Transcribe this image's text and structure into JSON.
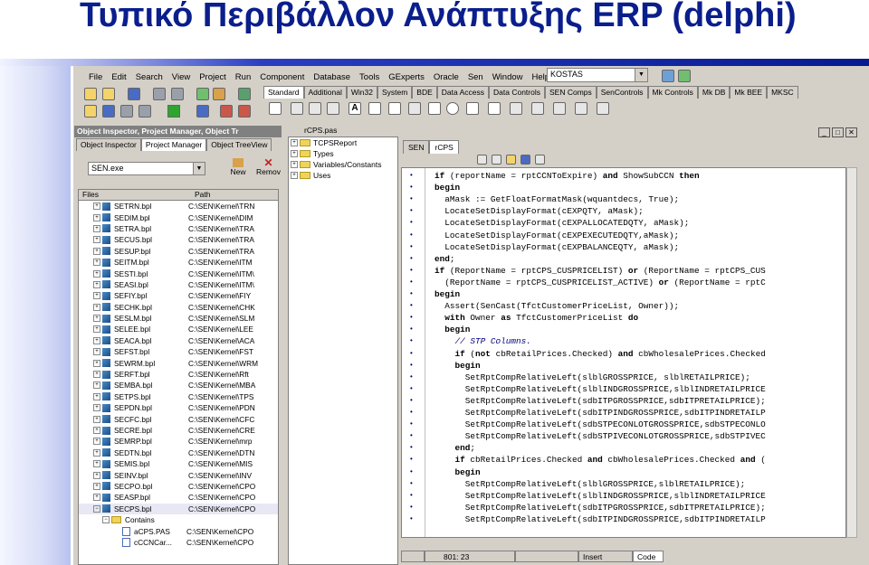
{
  "slide": {
    "title": "Τυπικό Περιβάλλον Ανάπτυξης ERP (delphi)"
  },
  "menu": [
    "File",
    "Edit",
    "Search",
    "View",
    "Project",
    "Run",
    "Component",
    "Database",
    "Tools",
    "GExperts",
    "Oracle",
    "Sen",
    "Window",
    "Help"
  ],
  "combo_value": "KOSTAS",
  "palette_tabs": [
    "Standard",
    "Additional",
    "Win32",
    "System",
    "BDE",
    "Data Access",
    "Data Controls",
    "SEN Comps",
    "SenControls",
    "Mk Controls",
    "Mk DB",
    "Mk BEE",
    "MKSC"
  ],
  "inspector": {
    "caption": "Object Inspector, Project Manager, Object Tr",
    "tabs": [
      "Object Inspector",
      "Project Manager",
      "Object TreeView"
    ],
    "project": "SEN.exe",
    "new_label": "New",
    "remove_label": "Remov",
    "col_files": "Files",
    "col_path": "Path",
    "files": [
      {
        "name": "SETRN.bpl",
        "path": "C:\\SEN\\Kernel\\TRN"
      },
      {
        "name": "SEDIM.bpl",
        "path": "C:\\SEN\\Kernel\\DIM"
      },
      {
        "name": "SETRA.bpl",
        "path": "C:\\SEN\\Kernel\\TRA"
      },
      {
        "name": "SECUS.bpl",
        "path": "C:\\SEN\\Kernel\\TRA"
      },
      {
        "name": "SESUP.bpl",
        "path": "C:\\SEN\\Kernel\\TRA"
      },
      {
        "name": "SEITM.bpl",
        "path": "C:\\SEN\\Kernel\\ITM"
      },
      {
        "name": "SESTI.bpl",
        "path": "C:\\SEN\\Kernel\\ITM\\"
      },
      {
        "name": "SEASI.bpl",
        "path": "C:\\SEN\\Kernel\\ITM\\"
      },
      {
        "name": "SEFIY.bpl",
        "path": "C:\\SEN\\Kernel\\FIY"
      },
      {
        "name": "SECHK.bpl",
        "path": "C:\\SEN\\Kernel\\CHK"
      },
      {
        "name": "SESLM.bpl",
        "path": "C:\\SEN\\Kernel\\SLM"
      },
      {
        "name": "SELEE.bpl",
        "path": "C:\\SEN\\Kernel\\LEE"
      },
      {
        "name": "SEACA.bpl",
        "path": "C:\\SEN\\Kernel\\ACA"
      },
      {
        "name": "SEFST.bpl",
        "path": "C:\\SEN\\Kernel\\FST"
      },
      {
        "name": "SEWRM.bpl",
        "path": "C:\\SEN\\Kernel\\WRM"
      },
      {
        "name": "SERFT.bpl",
        "path": "C:\\SEN\\Kernel\\Rft"
      },
      {
        "name": "SEMBA.bpl",
        "path": "C:\\SEN\\Kernel\\MBA"
      },
      {
        "name": "SETPS.bpl",
        "path": "C:\\SEN\\Kernel\\TPS"
      },
      {
        "name": "SEPDN.bpl",
        "path": "C:\\SEN\\Kernel\\PDN"
      },
      {
        "name": "SECFC.bpl",
        "path": "C:\\SEN\\Kernel\\CFC"
      },
      {
        "name": "SECRE.bpl",
        "path": "C:\\SEN\\Kernel\\CRE"
      },
      {
        "name": "SEMRP.bpl",
        "path": "C:\\SEN\\Kernel\\mrp"
      },
      {
        "name": "SEDTN.bpl",
        "path": "C:\\SEN\\Kernel\\DTN"
      },
      {
        "name": "SEMIS.bpl",
        "path": "C:\\SEN\\Kernel\\MIS"
      },
      {
        "name": "SEINV.bpl",
        "path": "C:\\SEN\\Kernel\\INV"
      },
      {
        "name": "SECPO.bpl",
        "path": "C:\\SEN\\Kernel\\CPO"
      },
      {
        "name": "SEASP.bpl",
        "path": "C:\\SEN\\Kernel\\CPO"
      },
      {
        "name": "SECPS.bpl",
        "path": "C:\\SEN\\Kernel\\CPO"
      }
    ],
    "contains": "Contains",
    "sub_files": [
      {
        "name": "aCPS.PAS",
        "path": "C:\\SEN\\Kernel\\CPO"
      },
      {
        "name": "cCCNCar...",
        "path": "C:\\SEN\\Kernel\\CPO"
      }
    ]
  },
  "tree": {
    "caption": "rCPS.pas",
    "items": [
      "TCPSReport",
      "Types",
      "Variables/Constants",
      "Uses"
    ]
  },
  "editor": {
    "tabs": [
      "SEN",
      "rCPS"
    ],
    "lines": [
      "if (reportName = rptCCNToExpire) and ShowSubCCN then",
      "begin",
      "  aMask := GetFloatFormatMask(wquantdecs, True);",
      "  LocateSetDisplayFormat(cEXPQTY, aMask);",
      "  LocateSetDisplayFormat(cEXPALLOCATEDQTY, aMask);",
      "  LocateSetDisplayFormat(cEXPEXECUTEDQTY,aMask);",
      "  LocateSetDisplayFormat(cEXPBALANCEQTY, aMask);",
      "end;",
      "if (ReportName = rptCPS_CUSPRICELIST) or (ReportName = rptCPS_CUS",
      "  (ReportName = rptCPS_CUSPRICELIST_ACTIVE) or (ReportName = rptC",
      "begin",
      "  Assert(SenCast(TfctCustomerPriceList, Owner));",
      "  with Owner as TfctCustomerPriceList do",
      "  begin",
      "    // STP Columns.",
      "    if (not cbRetailPrices.Checked) and cbWholesalePrices.Checked",
      "    begin",
      "      SetRptCompRelativeLeft(slblGROSSPRICE, slblRETAILPRICE);",
      "      SetRptCompRelativeLeft(slblINDGROSSPRICE,slblINDRETAILPRICE",
      "      SetRptCompRelativeLeft(sdbITPGROSSPRICE,sdbITPRETAILPRICE);",
      "      SetRptCompRelativeLeft(sdbITPINDGROSSPRICE,sdbITPINDRETAILP",
      "      SetRptCompRelativeLeft(sdbSTPECONLOTGROSSPRICE,sdbSTPECONLO",
      "      SetRptCompRelativeLeft(sdbSTPIVECONLOTGROSSPRICE,sdbSTPIVEC",
      "    end;",
      "    if cbRetailPrices.Checked and cbWholesalePrices.Checked and (",
      "    begin",
      "      SetRptCompRelativeLeft(slblGROSSPRICE,slblRETAILPRICE);",
      "      SetRptCompRelativeLeft(slblINDGROSSPRICE,slblINDRETAILPRICE",
      "      SetRptCompRelativeLeft(sdbITPGROSSPRICE,sdbITPRETAILPRICE);",
      "      SetRptCompRelativeLeft(sdbITPINDGROSSPRICE,sdbITPINDRETAILP"
    ],
    "status_pos": "801: 23",
    "status_mode": "Insert",
    "status_tab": "Code"
  }
}
